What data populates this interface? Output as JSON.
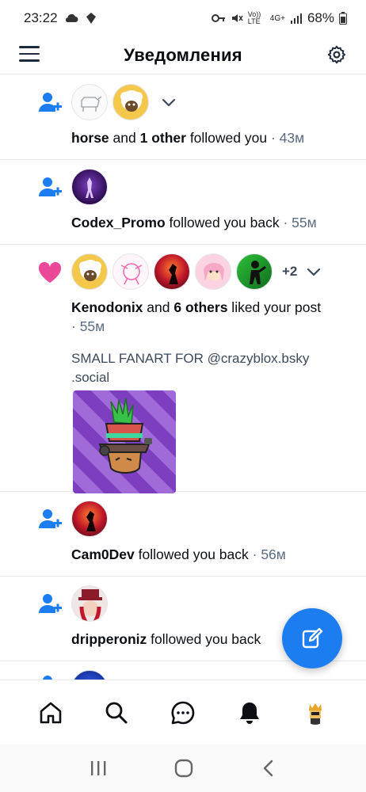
{
  "status_bar": {
    "time": "23:22",
    "network_labels": [
      "Vo)) LTE",
      "4G+"
    ],
    "battery": "68%"
  },
  "header": {
    "title": "Уведомления"
  },
  "notifications": [
    {
      "type": "follow",
      "icon": "person-plus-icon",
      "actor": "horse",
      "connector": " and ",
      "others": "1 other",
      "action": " followed you",
      "time": " · 43м",
      "avatars": [
        "horse-sketch",
        "sheep"
      ]
    },
    {
      "type": "follow-back",
      "icon": "person-plus-icon",
      "actor": "Codex_Promo",
      "action": " followed you back",
      "time": " · 55м",
      "avatars": [
        "purple-figure"
      ]
    },
    {
      "type": "like",
      "icon": "heart-icon",
      "actor": "Kenodonix",
      "connector": " and ",
      "others": "6 others",
      "action": " liked your post",
      "time": "· 55м",
      "more_count": "+2",
      "post_text": "SMALL FANART FOR @crazyblox.bsky .social",
      "avatars": [
        "sheep",
        "pink-sketch",
        "red-sunset",
        "pink-girl",
        "green-figure"
      ]
    },
    {
      "type": "follow-back",
      "icon": "person-plus-icon",
      "actor": "Cam0Dev",
      "action": " followed you back",
      "time": " · 56м",
      "avatars": [
        "red-sunset"
      ]
    },
    {
      "type": "follow-back",
      "icon": "person-plus-icon",
      "actor": "dripperoniz",
      "action": " followed you back",
      "time": "",
      "avatars": [
        "red-hat-girl"
      ]
    }
  ],
  "colors": {
    "accent": "#1b7df0",
    "like": "#ec4899",
    "text": "#0b0f14",
    "muted": "#5b6b80"
  },
  "bottom_nav": [
    "home-icon",
    "search-icon",
    "chat-icon",
    "bell-icon",
    "profile-avatar"
  ],
  "system_nav": [
    "recents-icon",
    "home-circle-icon",
    "back-icon"
  ]
}
